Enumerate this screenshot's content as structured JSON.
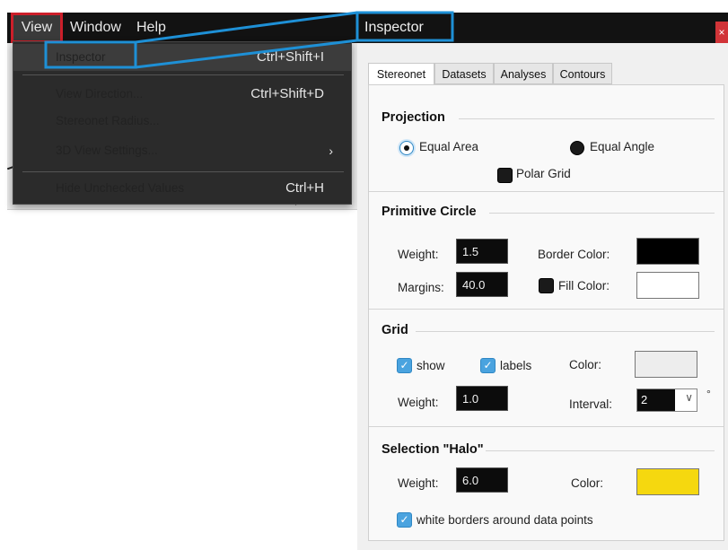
{
  "menubar": {
    "items": [
      "View",
      "Window",
      "Help"
    ]
  },
  "dropdown": {
    "items": [
      {
        "label": "Inspector",
        "shortcut": "Ctrl+Shift+I"
      },
      {
        "label": "View Direction...",
        "shortcut": "Ctrl+Shift+D"
      },
      {
        "label": "Stereonet Radius...",
        "shortcut": ""
      },
      {
        "label": "3D View Settings...",
        "shortcut": "",
        "submenu": true
      },
      {
        "label": "Hide Unchecked Values",
        "shortcut": "Ctrl+H"
      }
    ],
    "submenu_arrow": "›"
  },
  "inspector": {
    "title": "Inspector",
    "close": "×",
    "tabs": [
      "Stereonet",
      "Datasets",
      "Analyses",
      "Contours"
    ],
    "projection": {
      "title": "Projection",
      "equal_area": "Equal Area",
      "equal_angle": "Equal Angle",
      "polar_grid": "Polar Grid",
      "selected": "Equal Area"
    },
    "primitive": {
      "title": "Primitive Circle",
      "weight_label": "Weight:",
      "weight": "1.5",
      "margins_label": "Margins:",
      "margins": "40.0",
      "border_color_label": "Border Color:",
      "fill_color_label": "Fill Color:",
      "border_color": "#000000",
      "fill_color": "#ffffff"
    },
    "grid": {
      "title": "Grid",
      "show_label": "show",
      "labels_label": "labels",
      "color_label": "Color:",
      "color": "#ededed",
      "weight_label": "Weight:",
      "weight": "1.0",
      "interval_label": "Interval:",
      "interval": "2",
      "degree": "°",
      "chevron": "∨"
    },
    "halo": {
      "title": "Selection \"Halo\"",
      "weight_label": "Weight:",
      "weight": "6.0",
      "color_label": "Color:",
      "color": "#f5d80f",
      "white_borders_label": "white borders around data points"
    }
  },
  "colors": {
    "highlight_box": "#cc1f2a",
    "callout": "#1e90d6"
  }
}
